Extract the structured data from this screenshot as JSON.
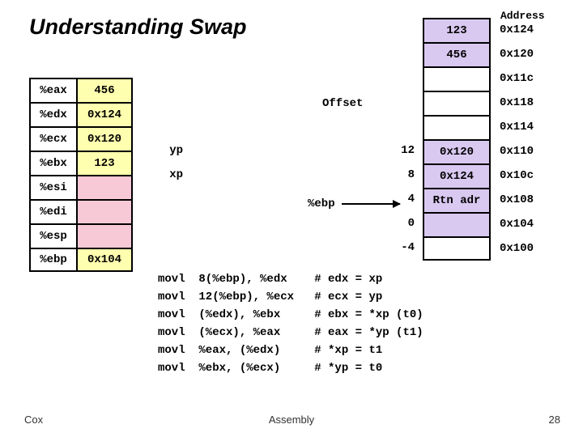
{
  "title": "Understanding Swap",
  "addr_header": "Address",
  "offset_label": "Offset",
  "ebp_label": "%ebp",
  "memory": [
    {
      "val": "123",
      "addr": "0x124",
      "bg": "mem-lav",
      "left": "",
      "off": ""
    },
    {
      "val": "456",
      "addr": "0x120",
      "bg": "mem-lav",
      "left": "",
      "off": ""
    },
    {
      "val": "",
      "addr": "0x11c",
      "bg": "",
      "left": "",
      "off": ""
    },
    {
      "val": "",
      "addr": "0x118",
      "bg": "",
      "left": "",
      "off": ""
    },
    {
      "val": "",
      "addr": "0x114",
      "bg": "",
      "left": "",
      "off": ""
    },
    {
      "val": "0x120",
      "addr": "0x110",
      "bg": "mem-lav",
      "left": "yp",
      "off": "12"
    },
    {
      "val": "0x124",
      "addr": "0x10c",
      "bg": "mem-lav",
      "left": "xp",
      "off": "8"
    },
    {
      "val": "Rtn adr",
      "addr": "0x108",
      "bg": "mem-lav",
      "left": "",
      "off": "4"
    },
    {
      "val": "",
      "addr": "0x104",
      "bg": "mem-lav",
      "left": "",
      "off": "0"
    },
    {
      "val": "",
      "addr": "0x100",
      "bg": "",
      "left": "",
      "off": "-4"
    }
  ],
  "registers": [
    {
      "name": "%eax",
      "val": "456",
      "bg": "val-yellow"
    },
    {
      "name": "%edx",
      "val": "0x124",
      "bg": "val-yellow"
    },
    {
      "name": "%ecx",
      "val": "0x120",
      "bg": "val-yellow"
    },
    {
      "name": "%ebx",
      "val": "123",
      "bg": "val-yellow"
    },
    {
      "name": "%esi",
      "val": "",
      "bg": "val-pink"
    },
    {
      "name": "%edi",
      "val": "",
      "bg": "val-pink"
    },
    {
      "name": "%esp",
      "val": "",
      "bg": "val-pink"
    },
    {
      "name": "%ebp",
      "val": "0x104",
      "bg": "val-yellow"
    }
  ],
  "code_lines": [
    "movl  8(%ebp), %edx    # edx = xp",
    "movl  12(%ebp), %ecx   # ecx = yp",
    "movl  (%edx), %ebx     # ebx = *xp (t0)",
    "movl  (%ecx), %eax     # eax = *yp (t1)",
    "movl  %eax, (%edx)     # *xp = t1",
    "movl  %ebx, (%ecx)     # *yp = t0"
  ],
  "footer": {
    "left": "Cox",
    "center": "Assembly",
    "right": "28"
  }
}
